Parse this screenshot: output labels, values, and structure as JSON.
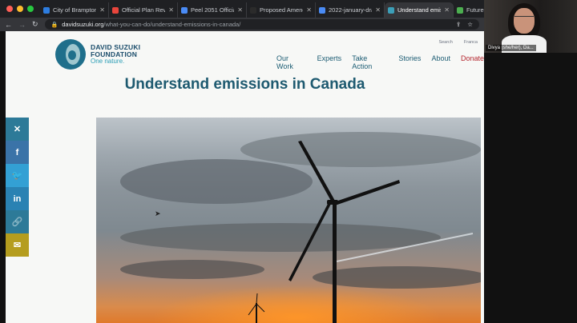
{
  "browser": {
    "tabs": [
      {
        "title": "City of Brampton |",
        "color": "#2d7de0",
        "active": false
      },
      {
        "title": "Official Plan Review",
        "color": "#e8453c",
        "active": false
      },
      {
        "title": "Peel 2051 Official",
        "color": "#4a8bf5",
        "active": false
      },
      {
        "title": "Proposed Amendm",
        "color": "#2b2b2b",
        "active": false
      },
      {
        "title": "2022-january-draf",
        "color": "#4a8bf5",
        "active": false
      },
      {
        "title": "Understand emissi",
        "color": "#3c9fb8",
        "active": true
      },
      {
        "title": "Future",
        "color": "#4caf50",
        "active": false
      }
    ],
    "url_domain": "davidsuzuki.org",
    "url_path": "/what-you-can-do/understand-emissions-in-canada/"
  },
  "webcam": {
    "name": "Divya (she/her), Da..."
  },
  "site": {
    "top_links": [
      "Search",
      "Franca"
    ],
    "logo_line1": "DAVID SUZUKI",
    "logo_line2": "FOUNDATION",
    "logo_tagline": "One nature.",
    "nav": [
      {
        "label": "Our Work"
      },
      {
        "label": "Experts"
      },
      {
        "label": "Take Action"
      },
      {
        "label": "Stories"
      },
      {
        "label": "About"
      },
      {
        "label": "Donate"
      }
    ],
    "page_title": "Understand emissions in Canada"
  },
  "share": [
    {
      "name": "close",
      "glyph": "✕",
      "color": "#2d7a98"
    },
    {
      "name": "facebook",
      "glyph": "f",
      "color": "#3a73a8"
    },
    {
      "name": "twitter",
      "glyph": "🐦",
      "color": "#33a0d4"
    },
    {
      "name": "linkedin",
      "glyph": "in",
      "color": "#2a82b3"
    },
    {
      "name": "link",
      "glyph": "🔗",
      "color": "#2d7a98"
    },
    {
      "name": "email",
      "glyph": "✉",
      "color": "#b59d1e"
    }
  ],
  "colors": {
    "brand": "#1b5c73",
    "donate": "#b4262e"
  }
}
